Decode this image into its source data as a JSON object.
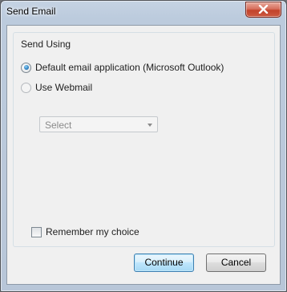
{
  "window": {
    "title": "Send Email",
    "close_icon": "close-icon"
  },
  "group": {
    "label": "Send Using",
    "options": [
      {
        "label": "Default email application (Microsoft Outlook)",
        "checked": true,
        "enabled": true
      },
      {
        "label": "Use Webmail",
        "checked": false,
        "enabled": false
      }
    ]
  },
  "webmail_select": {
    "value": "Select",
    "enabled": false
  },
  "remember": {
    "label": "Remember my choice",
    "checked": false
  },
  "buttons": {
    "continue_label": "Continue",
    "cancel_label": "Cancel"
  },
  "colors": {
    "default_button_border": "#3c7fb1",
    "close_button": "#c2422b",
    "radio_checked": "#2f7fbf"
  }
}
